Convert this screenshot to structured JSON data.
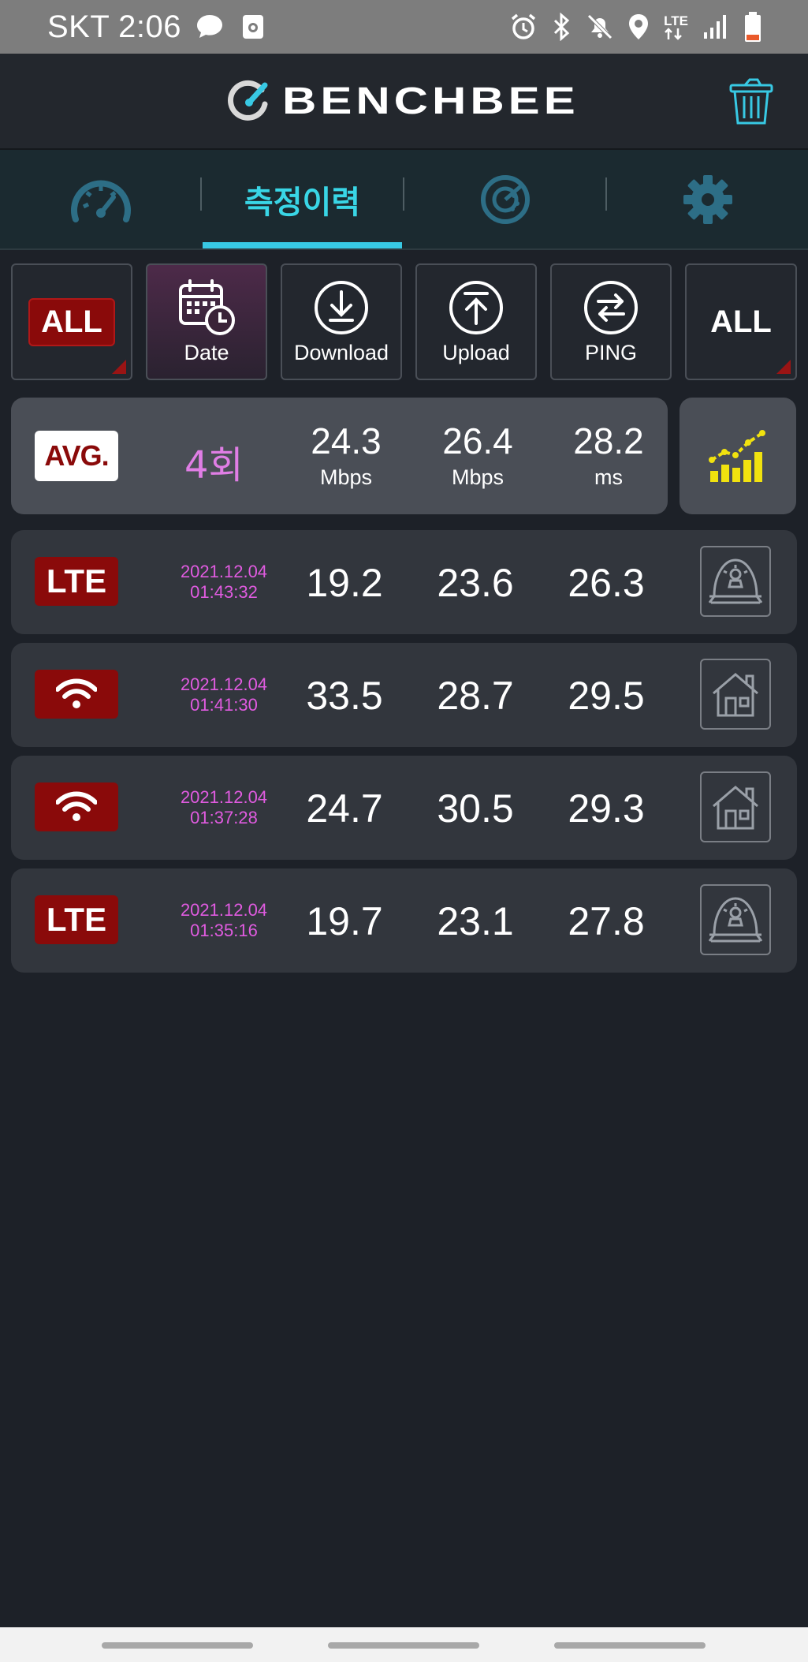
{
  "status_bar": {
    "carrier_time": "SKT 2:06",
    "network": "LTE",
    "icons": [
      "chat-icon",
      "gallery-icon",
      "alarm-icon",
      "bluetooth-icon",
      "mute-icon",
      "location-icon",
      "signal-icon",
      "battery-icon"
    ]
  },
  "app": {
    "brand": "BENCHBEE",
    "brand_color": "#38c9e4",
    "accent_red": "#8a0a0a"
  },
  "tabs": [
    {
      "id": "speedtest",
      "icon": "speedometer-icon",
      "label": ""
    },
    {
      "id": "history",
      "icon": "",
      "label": "측정이력",
      "active": true
    },
    {
      "id": "coverage",
      "icon": "radar-icon",
      "label": ""
    },
    {
      "id": "settings",
      "icon": "gear-icon",
      "label": ""
    }
  ],
  "filters": {
    "network_filter": "ALL",
    "date": "Date",
    "download": "Download",
    "upload": "Upload",
    "ping": "PING",
    "place_filter": "ALL"
  },
  "average": {
    "badge": "AVG.",
    "count": "4회",
    "download": {
      "value": "24.3",
      "unit": "Mbps"
    },
    "upload": {
      "value": "26.4",
      "unit": "Mbps"
    },
    "ping": {
      "value": "28.2",
      "unit": "ms"
    }
  },
  "records": [
    {
      "type": "LTE",
      "date": "2021.12.04",
      "time": "01:43:32",
      "download": "19.2",
      "upload": "23.6",
      "ping": "26.3",
      "place": "outdoor"
    },
    {
      "type": "wifi",
      "date": "2021.12.04",
      "time": "01:41:30",
      "download": "33.5",
      "upload": "28.7",
      "ping": "29.5",
      "place": "home"
    },
    {
      "type": "wifi",
      "date": "2021.12.04",
      "time": "01:37:28",
      "download": "24.7",
      "upload": "30.5",
      "ping": "29.3",
      "place": "home"
    },
    {
      "type": "LTE",
      "date": "2021.12.04",
      "time": "01:35:16",
      "download": "19.7",
      "upload": "23.1",
      "ping": "27.8",
      "place": "outdoor"
    }
  ]
}
